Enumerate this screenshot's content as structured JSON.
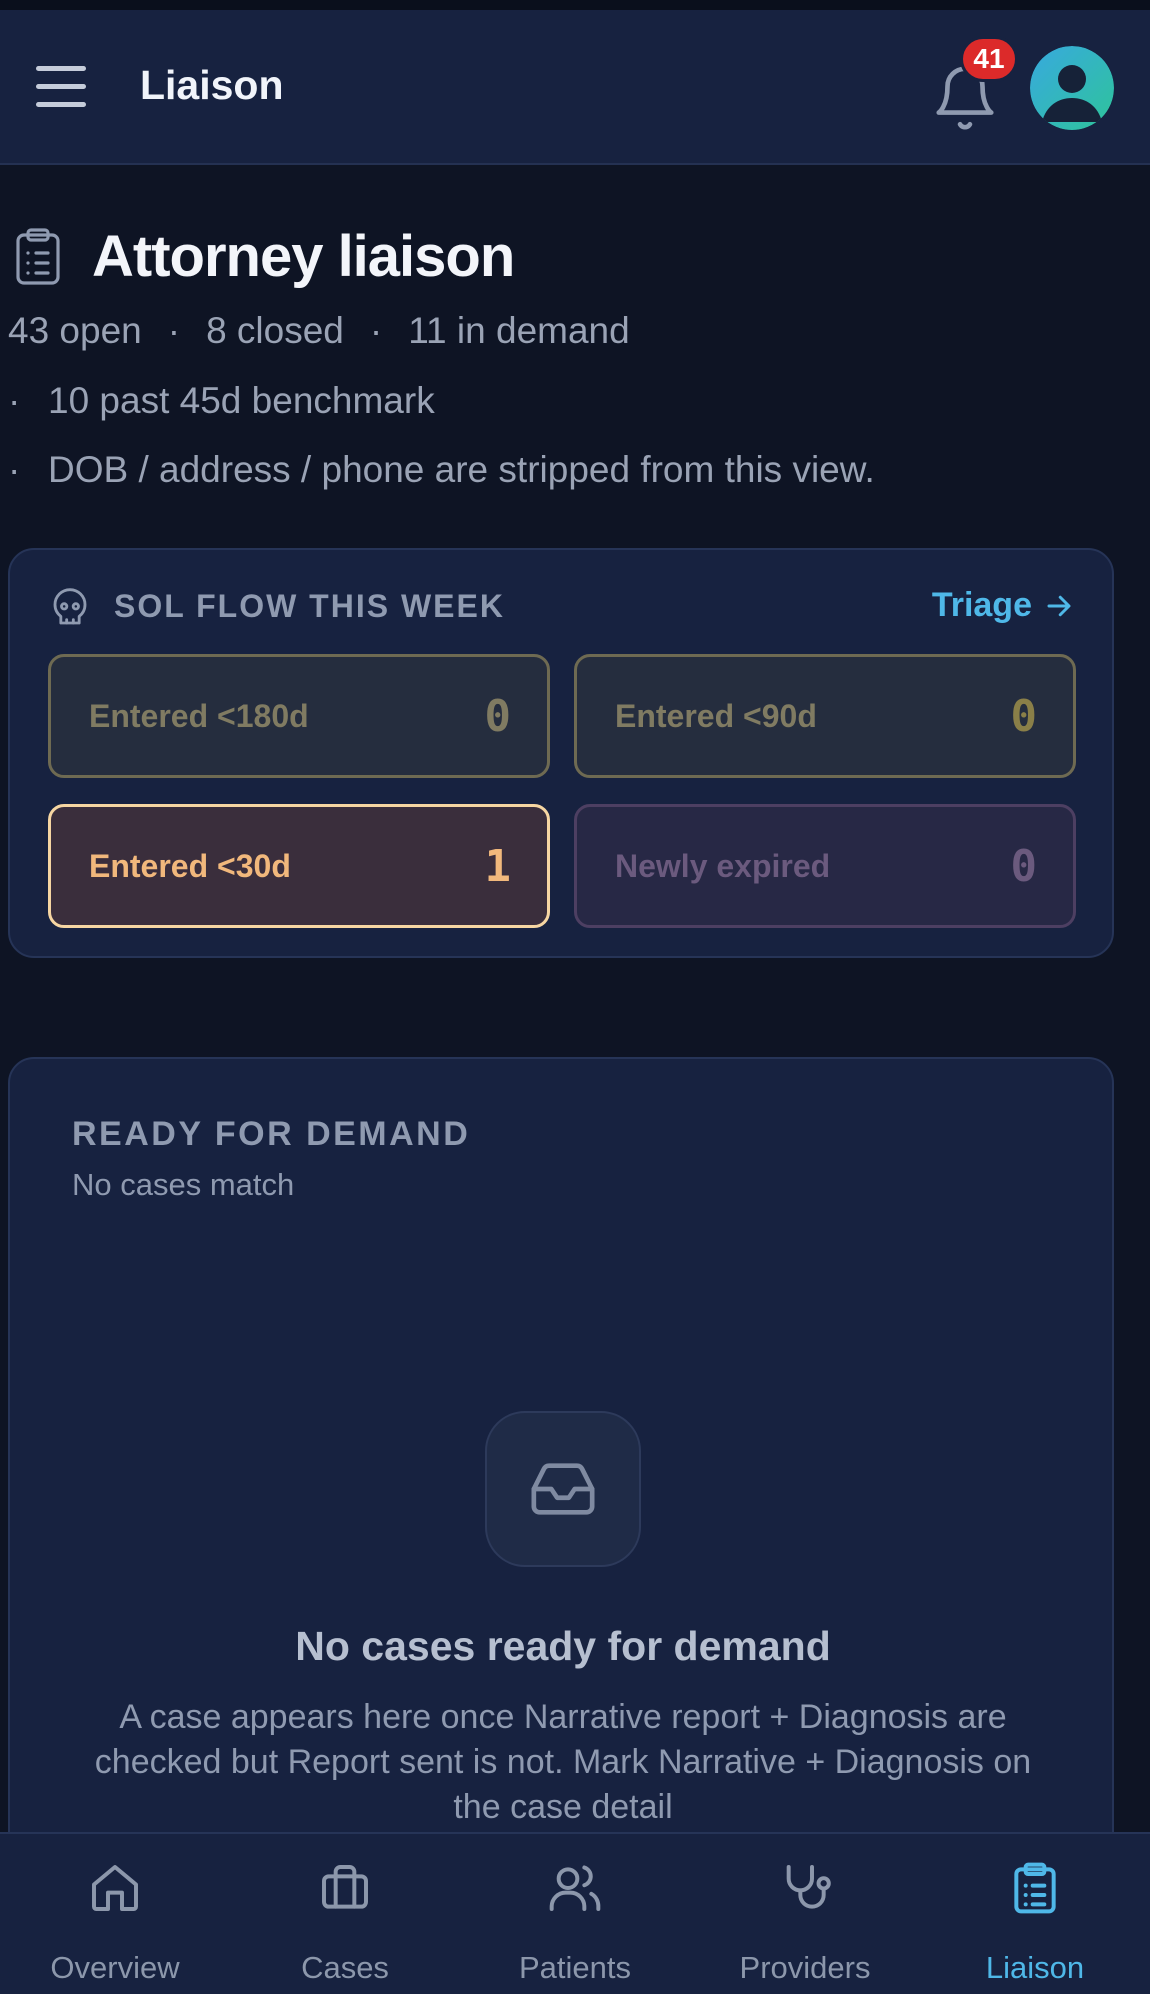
{
  "appbar": {
    "title": "Liaison",
    "notification_count": "41"
  },
  "page": {
    "title": "Attorney liaison",
    "open": "43 open",
    "closed": "8 closed",
    "in_demand": "11 in demand",
    "past_benchmark": "10 past 45d benchmark",
    "privacy_note": "DOB / address / phone are stripped from this view.",
    "separator": "·"
  },
  "sol_flow": {
    "title": "SOL FLOW THIS WEEK",
    "action_label": "Triage",
    "tiles": [
      {
        "label": "Entered <180d",
        "count": "0"
      },
      {
        "label": "Entered <90d",
        "count": "0"
      },
      {
        "label": "Entered <30d",
        "count": "1"
      },
      {
        "label": "Newly expired",
        "count": "0"
      }
    ]
  },
  "demand": {
    "title": "READY FOR DEMAND",
    "subtitle": "No cases match",
    "empty_title": "No cases ready for demand",
    "empty_body": "A case appears here once Narrative report + Diagnosis are checked but Report sent is not. Mark Narrative + Diagnosis on the case detail"
  },
  "bottom_nav": [
    {
      "label": "Overview",
      "icon": "home-icon"
    },
    {
      "label": "Cases",
      "icon": "briefcase-icon"
    },
    {
      "label": "Patients",
      "icon": "users-icon"
    },
    {
      "label": "Providers",
      "icon": "stethoscope-icon"
    },
    {
      "label": "Liaison",
      "icon": "clipboard-icon",
      "active": true
    }
  ],
  "colors": {
    "background": "#0e1424",
    "card": "#172240",
    "accent": "#4fb8e8",
    "badge": "#dc2a2a",
    "warning_tile_border": "#f6d6a2"
  }
}
